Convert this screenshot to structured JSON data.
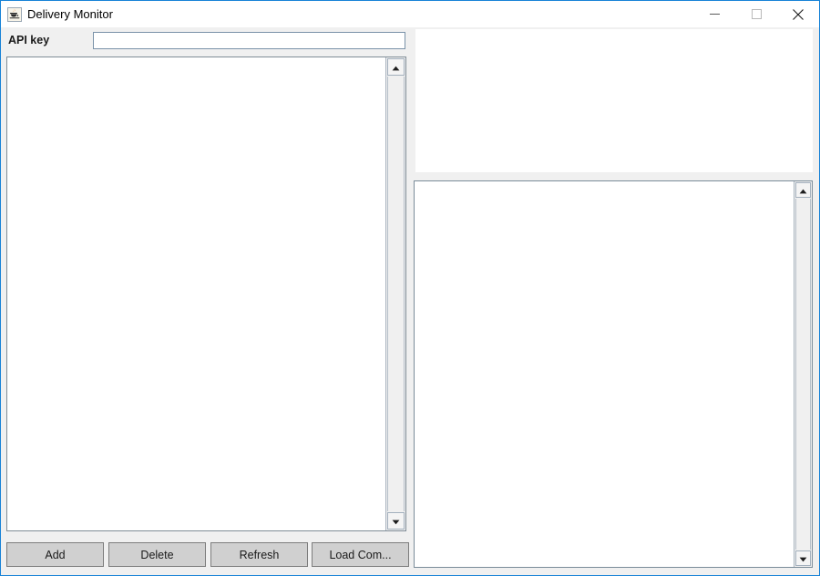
{
  "window": {
    "title": "Delivery Monitor",
    "icon": "java-coffee-cup-icon",
    "accent_border": "#1883d7",
    "titlebar_bg": "#ffffff",
    "controls": {
      "minimize": "minimize-icon",
      "maximize": "maximize-icon",
      "close": "close-icon"
    }
  },
  "form": {
    "api_key_label": "API key",
    "api_key_value": "",
    "api_key_placeholder": ""
  },
  "left_panel": {
    "list_items": [],
    "scrollbar": {
      "up_arrow": "scroll-up-icon",
      "down_arrow": "scroll-down-icon"
    }
  },
  "buttons": [
    {
      "id": "add",
      "label": "Add"
    },
    {
      "id": "delete",
      "label": "Delete"
    },
    {
      "id": "refresh",
      "label": "Refresh"
    },
    {
      "id": "load",
      "label": "Load Com..."
    }
  ],
  "right_top_panel": {
    "content": ""
  },
  "right_bottom_panel": {
    "content": "",
    "scrollbar": {
      "up_arrow": "scroll-up-icon",
      "down_arrow": "scroll-down-icon"
    }
  },
  "colors": {
    "window_bg": "#f0f0f0",
    "panel_bg": "#ffffff",
    "button_bg": "#d0d0d0",
    "border": "#7f8c96"
  }
}
